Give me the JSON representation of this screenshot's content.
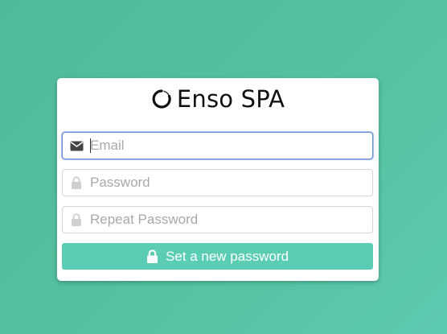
{
  "brand": {
    "name": "Enso SPA",
    "logo_icon": "enso-circle-icon"
  },
  "form": {
    "email": {
      "value": "",
      "placeholder": "Email",
      "icon": "envelope-icon"
    },
    "password": {
      "value": "",
      "placeholder": "Password",
      "icon": "lock-icon"
    },
    "repeat_password": {
      "value": "",
      "placeholder": "Repeat Password",
      "icon": "lock-icon"
    },
    "submit": {
      "label": "Set a new password",
      "icon": "lock-icon"
    }
  },
  "colors": {
    "background": "#55c09f",
    "button": "#5ccdb5",
    "focus_border": "#6d8fd8",
    "icon_active": "#444444",
    "icon_muted": "#cfcfcf"
  }
}
